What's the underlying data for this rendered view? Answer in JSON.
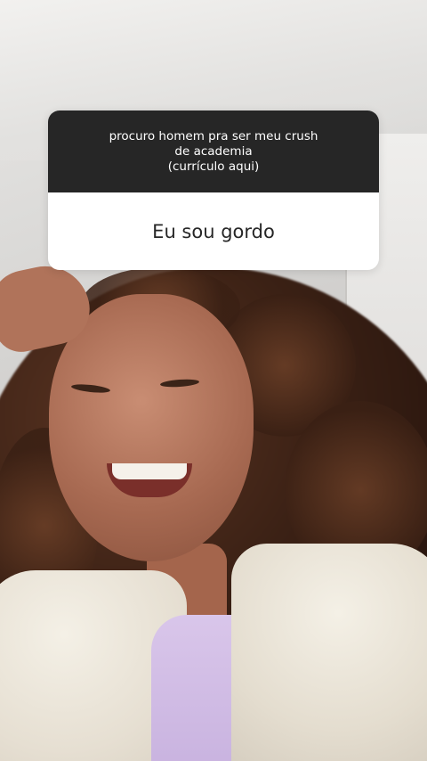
{
  "question_sticker": {
    "question_lines": [
      "procuro homem pra ser meu crush",
      "de academia",
      "(currículo aqui)"
    ],
    "answer": "Eu sou gordo"
  },
  "colors": {
    "sticker_header": "#262626",
    "sticker_body": "#ffffff",
    "sticker_text_light": "#ffffff",
    "sticker_text_dark": "#262626"
  }
}
